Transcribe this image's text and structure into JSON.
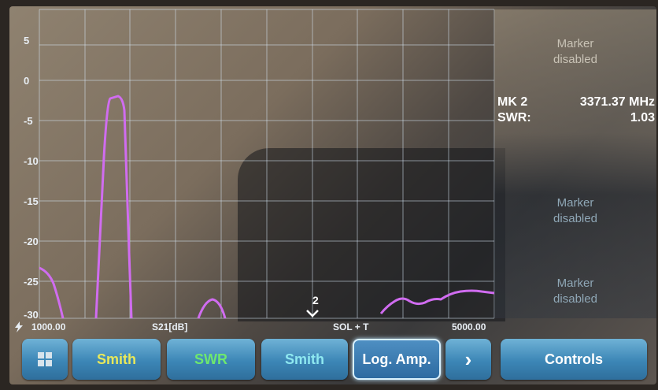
{
  "y_axis": {
    "ticks": [
      "5",
      "0",
      "-5",
      "-10",
      "-15",
      "-20",
      "-25",
      "-30"
    ]
  },
  "trace": {
    "color": "#d06cf0"
  },
  "marker_label": "2",
  "axis_bar": {
    "start": "1000.00",
    "param": "S21[dB]",
    "cal": "SOL + T",
    "stop": "5000.00"
  },
  "markers": {
    "slot1": {
      "line1": "Marker",
      "line2": "disabled"
    },
    "mk2": {
      "title": "MK 2",
      "freq": "3371.37 MHz",
      "swr_label": "SWR:",
      "swr_value": "1.03"
    },
    "slot3": {
      "line1": "Marker",
      "line2": "disabled"
    },
    "slot4": {
      "line1": "Marker",
      "line2": "disabled"
    }
  },
  "buttons": {
    "b1": "",
    "b2": "Smith",
    "b3": "SWR",
    "b4": "Smith",
    "b5": "Log. Amp.",
    "b6": "›",
    "b7": "Controls"
  },
  "colors": {
    "smith_yellow": "#e8e85a",
    "swr_green": "#6ee86e",
    "smith_teal": "#8ee8f0"
  }
}
